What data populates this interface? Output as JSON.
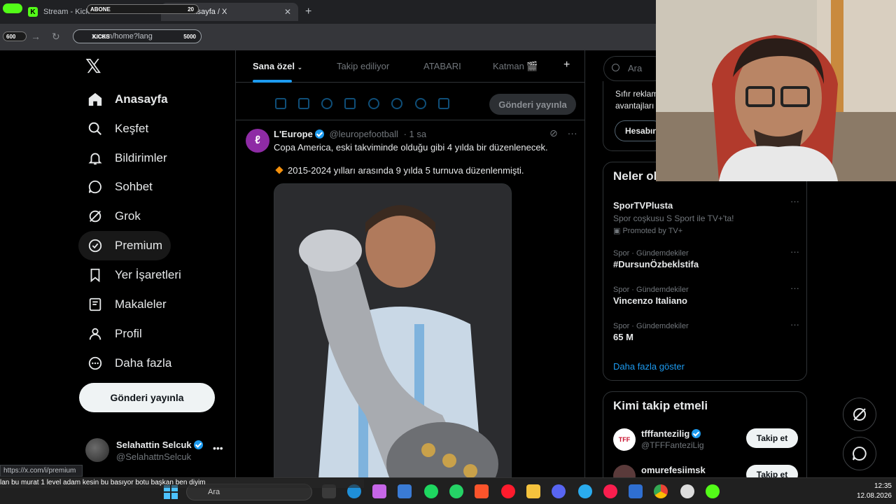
{
  "browser": {
    "tabs": [
      {
        "title": "Stream - Kick Dashboard",
        "favicon": "kick-icon"
      },
      {
        "title": "Anasayfa / X",
        "favicon": "x-logo-icon"
      }
    ],
    "url": "x.com/home?lang"
  },
  "overlay": {
    "abone_label": "ABONE",
    "abone_count": "20",
    "kicks_label": "KICKS",
    "kicks_count": "5000",
    "progress_label": "600"
  },
  "sidebar": {
    "items": [
      {
        "label": "Anasayfa",
        "icon": "home-icon"
      },
      {
        "label": "Keşfet",
        "icon": "search-icon"
      },
      {
        "label": "Bildirimler",
        "icon": "bell-icon"
      },
      {
        "label": "Sohbet",
        "icon": "chat-icon"
      },
      {
        "label": "Grok",
        "icon": "grok-icon"
      },
      {
        "label": "Premium",
        "icon": "premium-icon"
      },
      {
        "label": "Yer İşaretleri",
        "icon": "bookmark-icon"
      },
      {
        "label": "Makaleler",
        "icon": "articles-icon"
      },
      {
        "label": "Profil",
        "icon": "person-icon"
      },
      {
        "label": "Daha fazla",
        "icon": "more-circle-icon"
      }
    ],
    "post_button": "Gönderi yayınla",
    "account": {
      "name": "Selahattin Selcuk",
      "handle": "@SelahattnSelcuk"
    }
  },
  "main": {
    "tabs": [
      "Sana özel",
      "Takip ediliyor",
      "ATABARI",
      "Katman 🎬"
    ],
    "composer_post_button": "Gönderi yayınla",
    "tweet": {
      "author": "L'Europe",
      "handle": "@leuropefootball",
      "time": "· 1 sa",
      "text": "Copa America, eski takviminde olduğu gibi 4 yılda bir düzenlenecek.",
      "bullet": "2015-2024 yılları arasında 9 yılda 5 turnuva düzenlenmişti."
    }
  },
  "right": {
    "search_placeholder": "Ara",
    "premium_text1": "Sıfır reklam",
    "premium_text2": "avantajları",
    "premium_button": "Hesabın",
    "trends_title": "Neler ol",
    "trends": [
      {
        "context": "",
        "name": "SporTVPlusta",
        "desc": "Spor coşkusu S Sport ile TV+'ta!",
        "promo": "Promoted by TV+"
      },
      {
        "context": "Spor · Gündemdekiler",
        "name": "#DursunÖzbekİstifa"
      },
      {
        "context": "Spor · Gündemdekiler",
        "name": "Vincenzo Italiano"
      },
      {
        "context": "Spor · Gündemdekiler",
        "name": "65 M"
      }
    ],
    "show_more": "Daha fazla göster",
    "follow_title": "Kimi takip etmeli",
    "follow": [
      {
        "name": "tfffantezilig",
        "handle": "@TFFFanteziLig",
        "button": "Takip et"
      },
      {
        "name": "omurefesiimsk",
        "handle": "",
        "button": "Takip et"
      }
    ]
  },
  "status": {
    "link_url": "https://x.com/i/premium",
    "chat_line": "lan bu murat 1 level adam kesin bu basıyor botu başkan ben diyim",
    "taskbar_search": "Ara",
    "time": "12:35",
    "date": "12.08.2026"
  },
  "colors": {
    "accent": "#1d9bf0",
    "kick": "#53fc18",
    "bg": "#000000"
  }
}
